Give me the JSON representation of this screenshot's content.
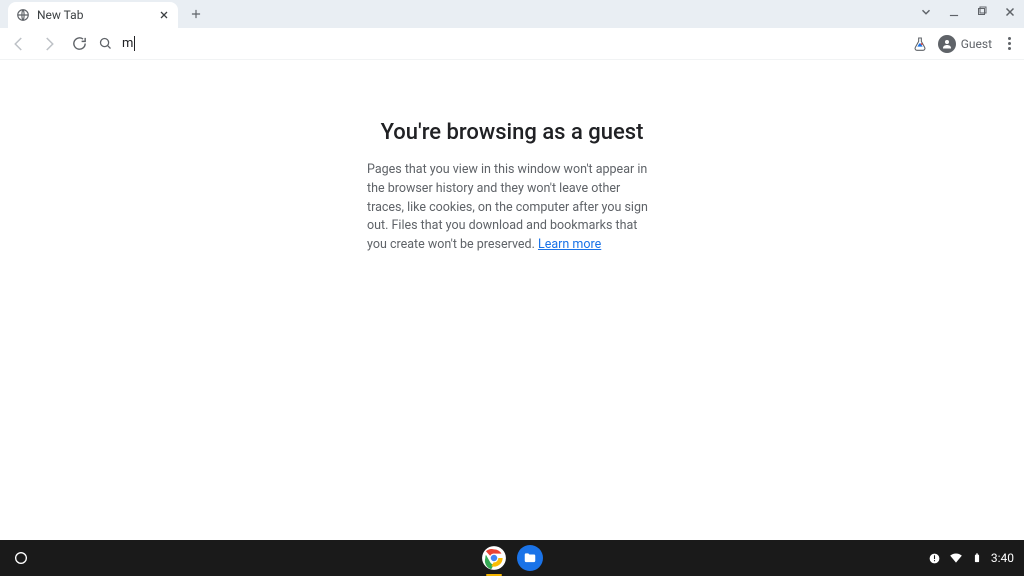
{
  "tab": {
    "title": "New Tab"
  },
  "omnibox": {
    "value": "m"
  },
  "profile": {
    "label": "Guest"
  },
  "guest_page": {
    "heading": "You're browsing as a guest",
    "body": "Pages that you view in this window won't appear in the browser history and they won't leave other traces, like cookies, on the computer after you sign out. Files that you download and bookmarks that you create won't be preserved. ",
    "learn_more": "Learn more"
  },
  "shelf": {
    "time": "3:40"
  }
}
